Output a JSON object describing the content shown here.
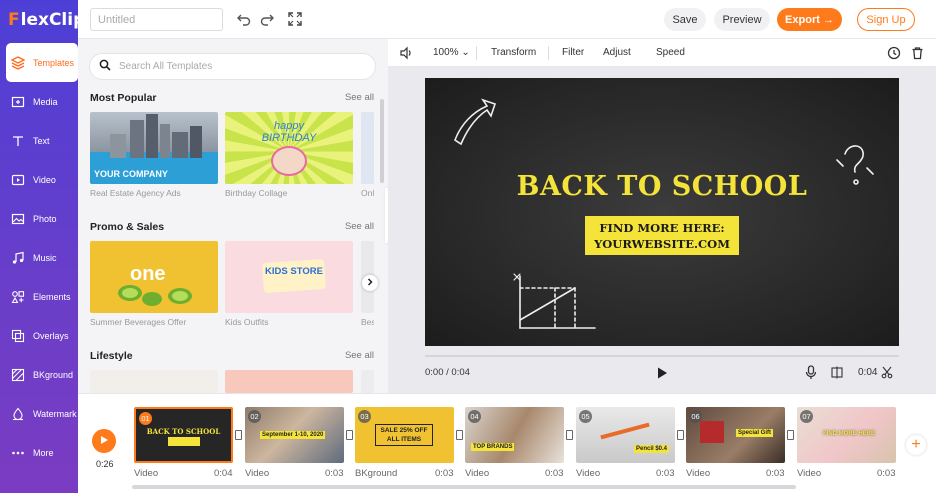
{
  "app": {
    "logo_text": "FlexClip",
    "accent": "#ff7a1a",
    "sidebar_color": "#5a3fd0"
  },
  "sidebar": {
    "items": [
      {
        "label": "Templates",
        "icon": "layers-icon",
        "active": true
      },
      {
        "label": "Media",
        "icon": "media-icon"
      },
      {
        "label": "Text",
        "icon": "text-icon"
      },
      {
        "label": "Video",
        "icon": "video-icon"
      },
      {
        "label": "Photo",
        "icon": "photo-icon"
      },
      {
        "label": "Music",
        "icon": "music-icon"
      },
      {
        "label": "Elements",
        "icon": "elements-icon"
      },
      {
        "label": "Overlays",
        "icon": "overlays-icon"
      },
      {
        "label": "BKground",
        "icon": "background-icon"
      },
      {
        "label": "Watermark",
        "icon": "watermark-icon"
      },
      {
        "label": "More",
        "icon": "more-dots-icon"
      }
    ]
  },
  "topbar": {
    "title_placeholder": "Untitled",
    "save_label": "Save",
    "preview_label": "Preview",
    "export_label": "Export →",
    "signup_label": "Sign Up"
  },
  "templates_panel": {
    "search_placeholder": "Search All Templates",
    "see_all": "See all",
    "sections": [
      {
        "title": "Most Popular",
        "items": [
          {
            "caption": "Real Estate Agency Ads",
            "overlay": "YOUR COMPANY"
          },
          {
            "caption": "Birthday Collage",
            "overlay": "happy BIRTHDAY"
          },
          {
            "caption": "Onl"
          }
        ]
      },
      {
        "title": "Promo & Sales",
        "items": [
          {
            "caption": "Summer Beverages Offer",
            "overlay": "one"
          },
          {
            "caption": "Kids Outfits",
            "overlay": "KIDS STORE"
          },
          {
            "caption": "Bes"
          }
        ]
      },
      {
        "title": "Lifestyle",
        "items": []
      }
    ]
  },
  "editor_toolbar": {
    "zoom": "100%",
    "transform": "Transform",
    "filter": "Filter",
    "adjust": "Adjust",
    "speed": "Speed"
  },
  "canvas": {
    "headline": "BACK TO SCHOOL",
    "line1": "FIND MORE HERE:",
    "line2": "YOURWEBSITE.COM"
  },
  "playback": {
    "time": "0:00 / 0:04",
    "duration": "0:04",
    "progress": 0
  },
  "timeline": {
    "current_time": "0:26",
    "clips": [
      {
        "num": "01",
        "type": "Video",
        "dur": "0:04",
        "selected": true
      },
      {
        "num": "02",
        "type": "Video",
        "dur": "0:03",
        "text": "September 1-10, 2020"
      },
      {
        "num": "03",
        "type": "BKground",
        "dur": "0:03",
        "text": "SALE 25% OFF ALL ITEMS"
      },
      {
        "num": "04",
        "type": "Video",
        "dur": "0:03",
        "text": "TOP BRANDS"
      },
      {
        "num": "05",
        "type": "Video",
        "dur": "0:03",
        "text": "Pencil $0.4"
      },
      {
        "num": "06",
        "type": "Video",
        "dur": "0:03",
        "text": "Special Gift"
      },
      {
        "num": "07",
        "type": "Video",
        "dur": "0:03",
        "text": "FIND MORE HERE"
      }
    ]
  }
}
